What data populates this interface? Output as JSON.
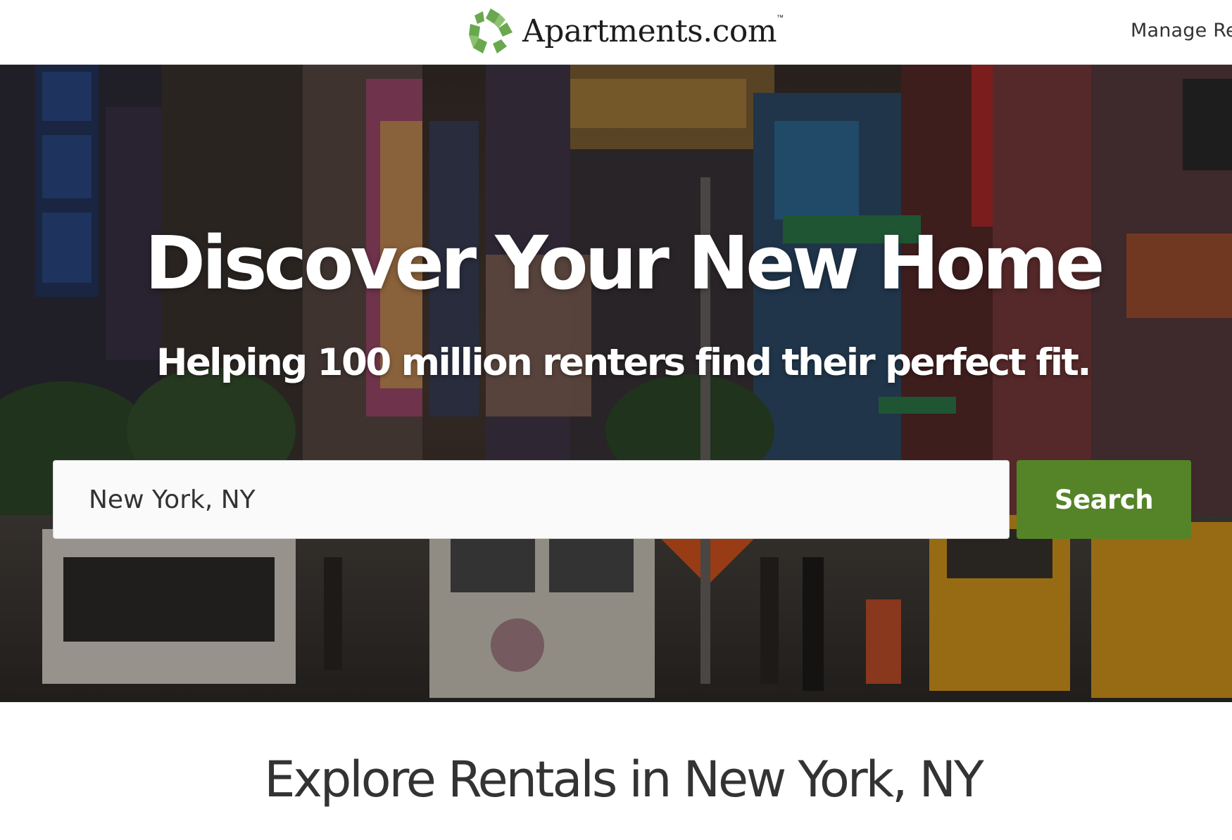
{
  "header": {
    "logo_text": "Apartments.com",
    "logo_tm": "™",
    "manage_link": "Manage Rentals"
  },
  "hero": {
    "title": "Discover Your New Home",
    "subtitle": "Helping 100 million renters find their perfect fit.",
    "search": {
      "value": "New York, NY",
      "button_label": "Search"
    }
  },
  "explore": {
    "title": "Explore Rentals in New York, NY"
  },
  "colors": {
    "brand_green": "#558428",
    "logo_green": "#6aa84f",
    "text_dark": "#333333"
  },
  "icons": {
    "logo_mark": "apartments-logo-icon"
  }
}
